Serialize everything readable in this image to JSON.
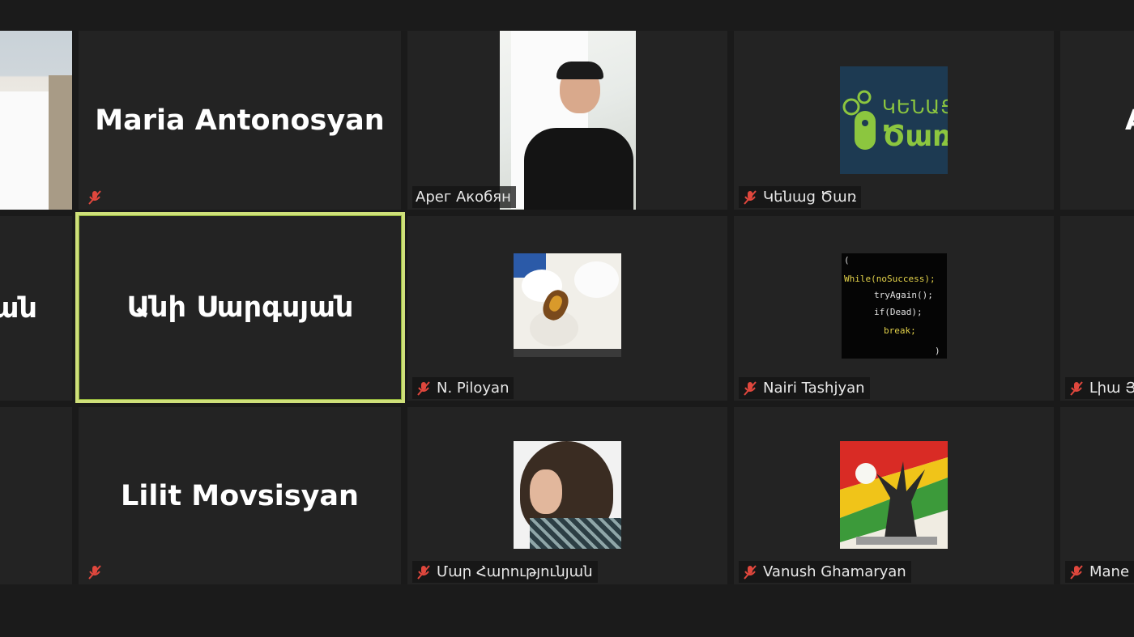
{
  "participants": {
    "maria": {
      "name": "Maria Antonosyan"
    },
    "arev": {
      "name": "Арег Акобян"
    },
    "kenats": {
      "name": "Կենաց Ծառ",
      "logo_line1": "ԿԵՆԱՑ",
      "logo_line2": "Ծառ"
    },
    "left_mid": {
      "name": "ան"
    },
    "ani": {
      "name": "Անի Սարգսյան"
    },
    "piloyan": {
      "name": "N. Piloyan"
    },
    "nairi": {
      "name": "Nairi Tashjyan",
      "code": [
        "(",
        "While(noSuccess);",
        "tryAgain();",
        "if(Dead);",
        "break;",
        ")"
      ]
    },
    "right_mid": {
      "name": "Լիա Յ"
    },
    "lilit": {
      "name": "Lilit Movsisyan"
    },
    "mar": {
      "name": "Մար Հարությունյան"
    },
    "vanush": {
      "name": "Vanush Ghamaryan"
    },
    "right_bot": {
      "name": "Mane"
    },
    "right_top": {
      "name": "A"
    }
  },
  "colors": {
    "tile_bg": "#232323",
    "active_border": "#cfe07a",
    "muted_icon": "#e0473d",
    "logo_bg": "#1d3a52",
    "logo_green": "#8cc63f"
  }
}
